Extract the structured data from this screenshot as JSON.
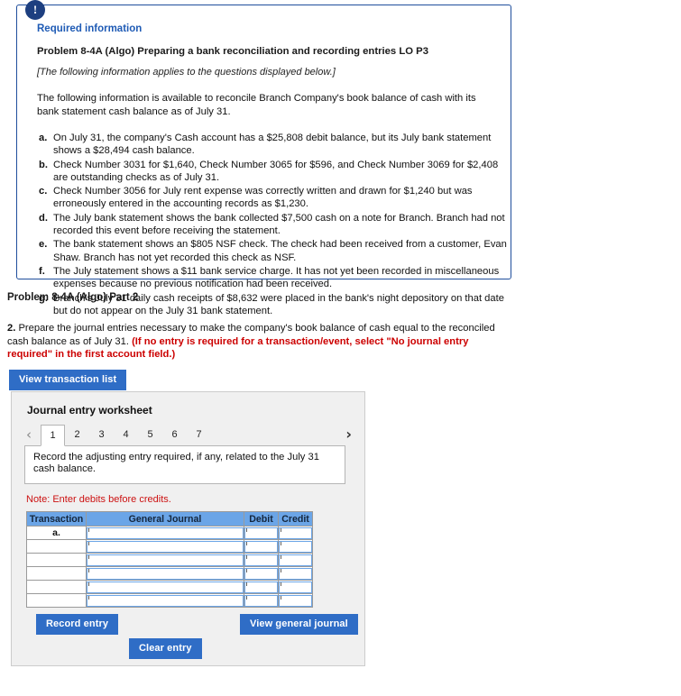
{
  "callout": {
    "badge_icon": "exclamation-icon",
    "heading": "Required information",
    "problem_title": "Problem 8-4A (Algo) Preparing a bank reconciliation and recording entries LO P3",
    "applies_note": "[The following information applies to the questions displayed below.]",
    "lead": "The following information is available to reconcile Branch Company's book balance of cash with its bank statement cash balance as of July 31.",
    "items": [
      {
        "marker": "a.",
        "text": "On July 31, the company's Cash account has a $25,808 debit balance, but its July bank statement shows a $28,494 cash balance."
      },
      {
        "marker": "b.",
        "text": "Check Number 3031 for $1,640, Check Number 3065 for $596, and Check Number 3069 for $2,408 are outstanding checks as of July 31."
      },
      {
        "marker": "c.",
        "text": "Check Number 3056 for July rent expense was correctly written and drawn for $1,240 but was erroneously entered in the accounting records as $1,230."
      },
      {
        "marker": "d.",
        "text": "The July bank statement shows the bank collected $7,500 cash on a note for Branch. Branch had not recorded this event before receiving the statement."
      },
      {
        "marker": "e.",
        "text": "The bank statement shows an $805 NSF check. The check had been received from a customer, Evan Shaw. Branch has not yet recorded this check as NSF."
      },
      {
        "marker": "f.",
        "text": "The July statement shows a $11 bank service charge. It has not yet been recorded in miscellaneous expenses because no previous notification had been received."
      },
      {
        "marker": "g.",
        "text": "Branch's July 31 daily cash receipts of $8,632 were placed in the bank's night depository on that date but do not appear on the July 31 bank statement."
      }
    ]
  },
  "part": {
    "title": "Problem 8-4A (Algo) Part 2",
    "question_number": "2.",
    "question_text": " Prepare the journal entries necessary to make the company's book balance of cash equal to the reconciled cash balance as of July 31. ",
    "question_red": "(If no entry is required for a transaction/event, select \"No journal entry required\" in the first account field.)",
    "view_transaction_list_label": "View transaction list"
  },
  "worksheet": {
    "title": "Journal entry worksheet",
    "prev_arrow": "‹",
    "next_arrow": "›",
    "tabs": [
      {
        "label": "1",
        "active": true
      },
      {
        "label": "2",
        "active": false
      },
      {
        "label": "3",
        "active": false
      },
      {
        "label": "4",
        "active": false
      },
      {
        "label": "5",
        "active": false
      },
      {
        "label": "6",
        "active": false
      },
      {
        "label": "7",
        "active": false
      }
    ],
    "instruction": "Record the adjusting entry required, if any, related to the July 31 cash balance.",
    "note": "Note: Enter debits before credits.",
    "table": {
      "headers": [
        "Transaction",
        "General Journal",
        "Debit",
        "Credit"
      ],
      "rows": [
        {
          "transaction": "a.",
          "general_journal": "",
          "debit": "",
          "credit": ""
        },
        {
          "transaction": "",
          "general_journal": "",
          "debit": "",
          "credit": ""
        },
        {
          "transaction": "",
          "general_journal": "",
          "debit": "",
          "credit": ""
        },
        {
          "transaction": "",
          "general_journal": "",
          "debit": "",
          "credit": ""
        },
        {
          "transaction": "",
          "general_journal": "",
          "debit": "",
          "credit": ""
        },
        {
          "transaction": "",
          "general_journal": "",
          "debit": "",
          "credit": ""
        }
      ]
    },
    "buttons": {
      "record_entry": "Record entry",
      "clear_entry": "Clear entry",
      "view_general_journal": "View general journal"
    }
  },
  "colors": {
    "callout_border": "#1f4e9c",
    "callout_heading": "#1f5bb5",
    "badge_bg": "#1d3f80",
    "button_blue": "#2f6dc6",
    "table_header_blue": "#6ba5e7",
    "red_text": "#cc0000",
    "note_red": "#cc1111",
    "panel_bg": "#f0f0f0"
  }
}
